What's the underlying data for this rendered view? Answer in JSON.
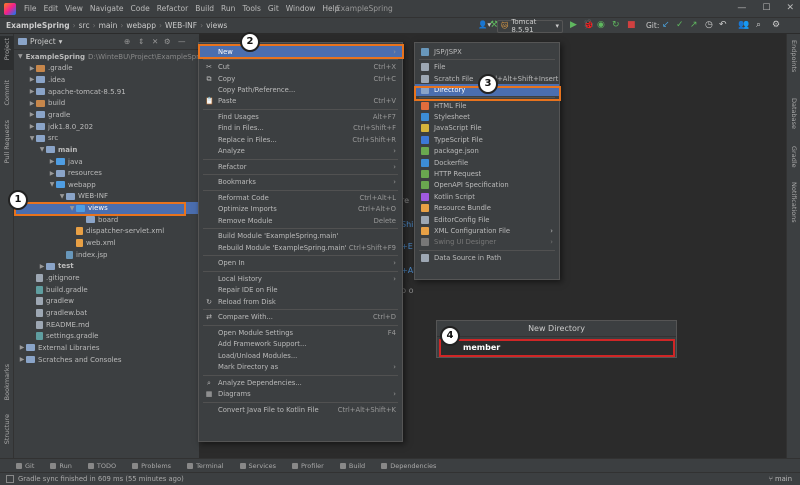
{
  "menubar": {
    "items": [
      "File",
      "Edit",
      "View",
      "Navigate",
      "Code",
      "Refactor",
      "Build",
      "Run",
      "Tools",
      "Git",
      "Window",
      "Help"
    ],
    "title": "ExampleSpring"
  },
  "navbar": {
    "crumbs": [
      "ExampleSpring",
      "src",
      "main",
      "webapp",
      "WEB-INF",
      "views"
    ],
    "run_config": "Tomcat 8.5.91",
    "git_label": "Git:"
  },
  "project": {
    "header": "Project"
  },
  "tree": [
    {
      "label": "ExampleSpring",
      "extra": "D:\\WinteBU\\Project\\ExampleSpring",
      "indent": 0,
      "kind": "folder",
      "arrow": "v",
      "bold": true
    },
    {
      "label": ".gradle",
      "indent": 1,
      "kind": "folder-or",
      "arrow": ">"
    },
    {
      "label": ".idea",
      "indent": 1,
      "kind": "folder",
      "arrow": ">"
    },
    {
      "label": "apache-tomcat-8.5.91",
      "indent": 1,
      "kind": "folder",
      "arrow": ">"
    },
    {
      "label": "build",
      "indent": 1,
      "kind": "folder-or",
      "arrow": ">"
    },
    {
      "label": "gradle",
      "indent": 1,
      "kind": "folder",
      "arrow": ">"
    },
    {
      "label": "jdk1.8.0_202",
      "indent": 1,
      "kind": "folder",
      "arrow": ">"
    },
    {
      "label": "src",
      "indent": 1,
      "kind": "folder",
      "arrow": "v"
    },
    {
      "label": "main",
      "indent": 2,
      "kind": "folder",
      "arrow": "v",
      "bold": true
    },
    {
      "label": "java",
      "indent": 3,
      "kind": "folder-bl",
      "arrow": ">"
    },
    {
      "label": "resources",
      "indent": 3,
      "kind": "folder",
      "arrow": ">"
    },
    {
      "label": "webapp",
      "indent": 3,
      "kind": "folder-bl",
      "arrow": "v"
    },
    {
      "label": "WEB-INF",
      "indent": 4,
      "kind": "folder",
      "arrow": "v"
    },
    {
      "label": "views",
      "indent": 5,
      "kind": "folder-bl",
      "arrow": "v",
      "selected": true
    },
    {
      "label": "board",
      "indent": 6,
      "kind": "folder",
      "arrow": ""
    },
    {
      "label": "dispatcher-servlet.xml",
      "indent": 5,
      "kind": "xml",
      "arrow": ""
    },
    {
      "label": "web.xml",
      "indent": 5,
      "kind": "xml",
      "arrow": ""
    },
    {
      "label": "index.jsp",
      "indent": 4,
      "kind": "jsp",
      "arrow": ""
    },
    {
      "label": "test",
      "indent": 2,
      "kind": "folder",
      "arrow": ">",
      "bold": true
    },
    {
      "label": ".gitignore",
      "indent": 1,
      "kind": "file",
      "arrow": ""
    },
    {
      "label": "build.gradle",
      "indent": 1,
      "kind": "gr",
      "arrow": ""
    },
    {
      "label": "gradlew",
      "indent": 1,
      "kind": "file",
      "arrow": ""
    },
    {
      "label": "gradlew.bat",
      "indent": 1,
      "kind": "file",
      "arrow": ""
    },
    {
      "label": "README.md",
      "indent": 1,
      "kind": "file",
      "arrow": ""
    },
    {
      "label": "settings.gradle",
      "indent": 1,
      "kind": "gr",
      "arrow": ""
    },
    {
      "label": "External Libraries",
      "indent": 0,
      "kind": "folder",
      "arrow": ">"
    },
    {
      "label": "Scratches and Consoles",
      "indent": 0,
      "kind": "folder",
      "arrow": ">"
    }
  ],
  "context_menu": [
    {
      "label": "New",
      "shortcut": "",
      "icon": "",
      "sub": true,
      "hl": true
    },
    {
      "sep": true
    },
    {
      "label": "Cut",
      "shortcut": "Ctrl+X",
      "icon": "✂"
    },
    {
      "label": "Copy",
      "shortcut": "Ctrl+C",
      "icon": "⧉"
    },
    {
      "label": "Copy Path/Reference...",
      "shortcut": "",
      "icon": ""
    },
    {
      "label": "Paste",
      "shortcut": "Ctrl+V",
      "icon": "📋"
    },
    {
      "sep": true
    },
    {
      "label": "Find Usages",
      "shortcut": "Alt+F7",
      "icon": ""
    },
    {
      "label": "Find in Files...",
      "shortcut": "Ctrl+Shift+F",
      "icon": ""
    },
    {
      "label": "Replace in Files...",
      "shortcut": "Ctrl+Shift+R",
      "icon": ""
    },
    {
      "label": "Analyze",
      "shortcut": "",
      "icon": "",
      "sub": true
    },
    {
      "sep": true
    },
    {
      "label": "Refactor",
      "shortcut": "",
      "icon": "",
      "sub": true
    },
    {
      "sep": true
    },
    {
      "label": "Bookmarks",
      "shortcut": "",
      "icon": "",
      "sub": true
    },
    {
      "sep": true
    },
    {
      "label": "Reformat Code",
      "shortcut": "Ctrl+Alt+L",
      "icon": ""
    },
    {
      "label": "Optimize Imports",
      "shortcut": "Ctrl+Alt+O",
      "icon": ""
    },
    {
      "label": "Remove Module",
      "shortcut": "Delete",
      "icon": ""
    },
    {
      "sep": true
    },
    {
      "label": "Build Module 'ExampleSpring.main'",
      "shortcut": "",
      "icon": ""
    },
    {
      "label": "Rebuild Module 'ExampleSpring.main'",
      "shortcut": "Ctrl+Shift+F9",
      "icon": ""
    },
    {
      "sep": true
    },
    {
      "label": "Open In",
      "shortcut": "",
      "icon": "",
      "sub": true
    },
    {
      "sep": true
    },
    {
      "label": "Local History",
      "shortcut": "",
      "icon": "",
      "sub": true
    },
    {
      "label": "Repair IDE on File",
      "shortcut": "",
      "icon": ""
    },
    {
      "label": "Reload from Disk",
      "shortcut": "",
      "icon": "↻"
    },
    {
      "sep": true
    },
    {
      "label": "Compare With...",
      "shortcut": "Ctrl+D",
      "icon": "⇄"
    },
    {
      "sep": true
    },
    {
      "label": "Open Module Settings",
      "shortcut": "F4",
      "icon": ""
    },
    {
      "label": "Add Framework Support...",
      "shortcut": "",
      "icon": ""
    },
    {
      "label": "Load/Unload Modules...",
      "shortcut": "",
      "icon": ""
    },
    {
      "label": "Mark Directory as",
      "shortcut": "",
      "icon": "",
      "sub": true
    },
    {
      "sep": true
    },
    {
      "label": "Analyze Dependencies...",
      "shortcut": "",
      "icon": "⌕"
    },
    {
      "label": "Diagrams",
      "shortcut": "",
      "icon": "▦",
      "sub": true
    },
    {
      "sep": true
    },
    {
      "label": "Convert Java File to Kotlin File",
      "shortcut": "Ctrl+Alt+Shift+K",
      "icon": ""
    }
  ],
  "submenu": [
    {
      "label": "JSP/JSPX",
      "color": "#6897bb"
    },
    {
      "sep": true
    },
    {
      "label": "File",
      "color": "#9da7b3"
    },
    {
      "label": "Scratch File",
      "shortcut": "Ctrl+Alt+Shift+Insert",
      "color": "#9da7b3"
    },
    {
      "label": "Directory",
      "color": "#8aa4c8",
      "hl": true
    },
    {
      "sep": true
    },
    {
      "label": "HTML File",
      "color": "#e06c3c"
    },
    {
      "label": "Stylesheet",
      "color": "#3c8dd6"
    },
    {
      "label": "JavaScript File",
      "color": "#d4b43c"
    },
    {
      "label": "TypeScript File",
      "color": "#3c78d8"
    },
    {
      "label": "package.json",
      "color": "#6aa84f"
    },
    {
      "label": "Dockerfile",
      "color": "#3c8dd6"
    },
    {
      "label": "HTTP Request",
      "color": "#6aa84f"
    },
    {
      "label": "OpenAPI Specification",
      "color": "#6aa84f"
    },
    {
      "label": "Kotlin Script",
      "color": "#a05ae0"
    },
    {
      "label": "Resource Bundle",
      "color": "#e8a045"
    },
    {
      "label": "EditorConfig File",
      "color": "#9da7b3"
    },
    {
      "label": "XML Configuration File",
      "color": "#e8a045",
      "sub": true
    },
    {
      "label": "Swing UI Designer",
      "color": "#777",
      "sub": true,
      "dim": true
    },
    {
      "sep": true
    },
    {
      "label": "Data Source in Path",
      "color": "#9da7b3"
    }
  ],
  "new_directory": {
    "title": "New Directory",
    "value": "member"
  },
  "badges": [
    "1",
    "2",
    "3",
    "4"
  ],
  "left_strip": [
    "Project",
    "Commit",
    "Pull Requests",
    "Bookmarks",
    "Structure"
  ],
  "right_strip": [
    "Endpoints",
    "Database",
    "Gradle",
    "Notifications"
  ],
  "bottom_tabs": [
    "Git",
    "Run",
    "TODO",
    "Problems",
    "Terminal",
    "Services",
    "Profiler",
    "Build",
    "Dependencies"
  ],
  "status": {
    "text": "Gradle sync finished in 609 ms (55 minutes ago)",
    "branch": "main"
  }
}
